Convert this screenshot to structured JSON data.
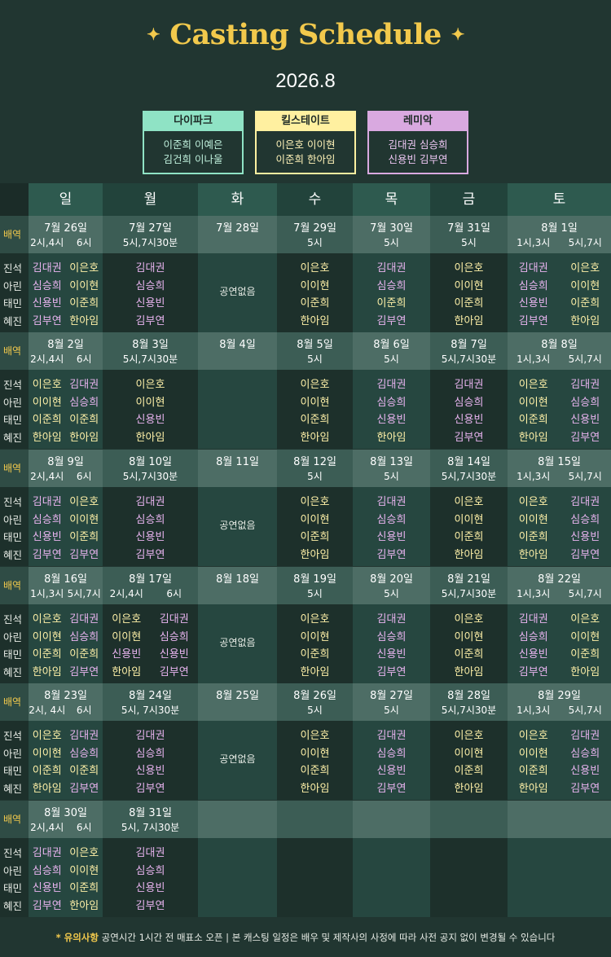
{
  "title": "Casting Schedule",
  "month": "2026.8",
  "colors": {
    "background": "#213631",
    "gold": "#f2c94c",
    "team1": "#8fe3c5",
    "team2": "#fff0a0",
    "team3": "#d9a9e0"
  },
  "teams": [
    {
      "name": "다이파크",
      "line1": "이준희 이예은",
      "line2": "김건희 이나울"
    },
    {
      "name": "킬스테이트",
      "line1": "이은호 이이현",
      "line2": "이준희 한아임"
    },
    {
      "name": "레미악",
      "line1": "김대권 심승희",
      "line2": "신용빈 김부연"
    }
  ],
  "days": [
    "일",
    "월",
    "화",
    "수",
    "목",
    "금",
    "토"
  ],
  "label_beayeok": "배역",
  "roles": [
    "진석",
    "아린",
    "태민",
    "혜진"
  ],
  "no_show": "공연없음",
  "weeks": [
    {
      "dates": [
        {
          "date": "7월 26일",
          "times": [
            "2시,4시",
            "6시"
          ]
        },
        {
          "date": "7월 27일",
          "times": [
            "5시,7시30분"
          ]
        },
        {
          "date": "7월 28일",
          "times": []
        },
        {
          "date": "7월 29일",
          "times": [
            "5시"
          ]
        },
        {
          "date": "7월 30일",
          "times": [
            "5시"
          ]
        },
        {
          "date": "7월 31일",
          "times": [
            "5시"
          ]
        },
        {
          "date": "8월 1일",
          "times": [
            "1시,3시",
            "5시,7시"
          ]
        }
      ],
      "cast": [
        [
          [
            "김대권",
            "심승희",
            "신용빈",
            "김부연"
          ],
          [
            "이은호",
            "이이현",
            "이준희",
            "한아임"
          ]
        ],
        [
          [
            "김대권",
            "심승희",
            "신용빈",
            "김부연"
          ]
        ],
        "none",
        [
          [
            "이은호",
            "이이현",
            "이준희",
            "한아임"
          ]
        ],
        [
          [
            "김대권",
            "심승희",
            "이준희",
            "김부연"
          ]
        ],
        [
          [
            "이은호",
            "이이현",
            "이준희",
            "한아임"
          ]
        ],
        [
          [
            "김대권",
            "심승희",
            "신용빈",
            "김부연"
          ],
          [
            "이은호",
            "이이현",
            "이준희",
            "한아임"
          ]
        ]
      ]
    },
    {
      "dates": [
        {
          "date": "8월 2일",
          "times": [
            "2시,4시",
            "6시"
          ]
        },
        {
          "date": "8월 3일",
          "times": [
            "5시,7시30분"
          ]
        },
        {
          "date": "8월 4일",
          "times": []
        },
        {
          "date": "8월 5일",
          "times": [
            "5시"
          ]
        },
        {
          "date": "8월 6일",
          "times": [
            "5시"
          ]
        },
        {
          "date": "8월 7일",
          "times": [
            "5시,7시30분"
          ]
        },
        {
          "date": "8월 8일",
          "times": [
            "1시,3시",
            "5시,7시"
          ]
        }
      ],
      "cast": [
        [
          [
            "이은호",
            "이이현",
            "이준희",
            "한아임"
          ],
          [
            "김대권",
            "심승희",
            "이준희",
            "한아임"
          ]
        ],
        [
          [
            "이은호",
            "이이현",
            "신용빈",
            "한아임"
          ]
        ],
        "empty",
        [
          [
            "이은호",
            "이이현",
            "이준희",
            "한아임"
          ]
        ],
        [
          [
            "김대권",
            "심승희",
            "신용빈",
            "한아임"
          ]
        ],
        [
          [
            "김대권",
            "심승희",
            "신용빈",
            "김부연"
          ]
        ],
        [
          [
            "이은호",
            "이이현",
            "이준희",
            "한아임"
          ],
          [
            "김대권",
            "심승희",
            "신용빈",
            "김부연"
          ]
        ]
      ]
    },
    {
      "dates": [
        {
          "date": "8월 9일",
          "times": [
            "2시,4시",
            "6시"
          ]
        },
        {
          "date": "8월 10일",
          "times": [
            "5시,7시30분"
          ]
        },
        {
          "date": "8월 11일",
          "times": []
        },
        {
          "date": "8월 12일",
          "times": [
            "5시"
          ]
        },
        {
          "date": "8월 13일",
          "times": [
            "5시"
          ]
        },
        {
          "date": "8월 14일",
          "times": [
            "5시,7시30분"
          ]
        },
        {
          "date": "8월 15일",
          "times": [
            "1시,3시",
            "5시,7시"
          ]
        }
      ],
      "cast": [
        [
          [
            "김대권",
            "심승희",
            "신용빈",
            "김부연"
          ],
          [
            "이은호",
            "이이현",
            "이준희",
            "김부연"
          ]
        ],
        [
          [
            "김대권",
            "심승희",
            "신용빈",
            "김부연"
          ]
        ],
        "none",
        [
          [
            "이은호",
            "이이현",
            "이준희",
            "한아임"
          ]
        ],
        [
          [
            "김대권",
            "심승희",
            "신용빈",
            "김부연"
          ]
        ],
        [
          [
            "이은호",
            "이이현",
            "이준희",
            "한아임"
          ]
        ],
        [
          [
            "이은호",
            "이이현",
            "이준희",
            "한아임"
          ],
          [
            "김대권",
            "심승희",
            "신용빈",
            "김부연"
          ]
        ]
      ]
    },
    {
      "dates": [
        {
          "date": "8월 16일",
          "times": [
            "1시,3시",
            "5시,7시"
          ]
        },
        {
          "date": "8월 17일",
          "times": [
            "2시,4시",
            "6시"
          ]
        },
        {
          "date": "8월 18일",
          "times": []
        },
        {
          "date": "8월 19일",
          "times": [
            "5시"
          ]
        },
        {
          "date": "8월 20일",
          "times": [
            "5시"
          ]
        },
        {
          "date": "8월 21일",
          "times": [
            "5시,7시30분"
          ]
        },
        {
          "date": "8월 22일",
          "times": [
            "1시,3시",
            "5시,7시"
          ]
        }
      ],
      "cast": [
        [
          [
            "이은호",
            "이이현",
            "이준희",
            "한아임"
          ],
          [
            "김대권",
            "심승희",
            "이준희",
            "김부연"
          ]
        ],
        [
          [
            "이은호",
            "이이현",
            "신용빈",
            "한아임"
          ],
          [
            "김대권",
            "심승희",
            "신용빈",
            "김부연"
          ]
        ],
        "none",
        [
          [
            "이은호",
            "이이현",
            "이준희",
            "한아임"
          ]
        ],
        [
          [
            "김대권",
            "심승희",
            "신용빈",
            "김부연"
          ]
        ],
        [
          [
            "이은호",
            "이이현",
            "이준희",
            "한아임"
          ]
        ],
        [
          [
            "김대권",
            "심승희",
            "신용빈",
            "김부연"
          ],
          [
            "이은호",
            "이이현",
            "이준희",
            "한아임"
          ]
        ]
      ]
    },
    {
      "dates": [
        {
          "date": "8월 23일",
          "times": [
            "2시, 4시",
            "6시"
          ]
        },
        {
          "date": "8월 24일",
          "times": [
            "5시, 7시30분"
          ]
        },
        {
          "date": "8월 25일",
          "times": []
        },
        {
          "date": "8월 26일",
          "times": [
            "5시"
          ]
        },
        {
          "date": "8월 27일",
          "times": [
            "5시"
          ]
        },
        {
          "date": "8월 28일",
          "times": [
            "5시,7시30분"
          ]
        },
        {
          "date": "8월 29일",
          "times": [
            "1시,3시",
            "5시,7시"
          ]
        }
      ],
      "cast": [
        [
          [
            "이은호",
            "이이현",
            "이준희",
            "한아임"
          ],
          [
            "김대권",
            "심승희",
            "이준희",
            "김부연"
          ]
        ],
        [
          [
            "김대권",
            "심승희",
            "신용빈",
            "김부연"
          ]
        ],
        "none",
        [
          [
            "이은호",
            "이이현",
            "이준희",
            "한아임"
          ]
        ],
        [
          [
            "김대권",
            "심승희",
            "신용빈",
            "김부연"
          ]
        ],
        [
          [
            "이은호",
            "이이현",
            "이준희",
            "한아임"
          ]
        ],
        [
          [
            "이은호",
            "이이현",
            "이준희",
            "한아임"
          ],
          [
            "김대권",
            "심승희",
            "신용빈",
            "김부연"
          ]
        ]
      ]
    },
    {
      "dates": [
        {
          "date": "8월 30일",
          "times": [
            "2시,4시",
            "6시"
          ]
        },
        {
          "date": "8월 31일",
          "times": [
            "5시, 7시30분"
          ]
        },
        null,
        null,
        null,
        null,
        null
      ],
      "cast": [
        [
          [
            "김대권",
            "심승희",
            "신용빈",
            "김부연"
          ],
          [
            "이은호",
            "이이현",
            "이준희",
            "한아임"
          ]
        ],
        [
          [
            "김대권",
            "심승희",
            "신용빈",
            "김부연"
          ]
        ],
        "empty",
        "empty",
        "empty",
        "empty",
        "empty"
      ]
    }
  ],
  "footer": {
    "note_label": "* 유의사항",
    "text": "공연시간 1시간 전 매표소 오픈 | 본 캐스팅 일정은 배우 및 제작사의 사정에 따라 사전 공지 없이 변경될 수 있습니다"
  }
}
